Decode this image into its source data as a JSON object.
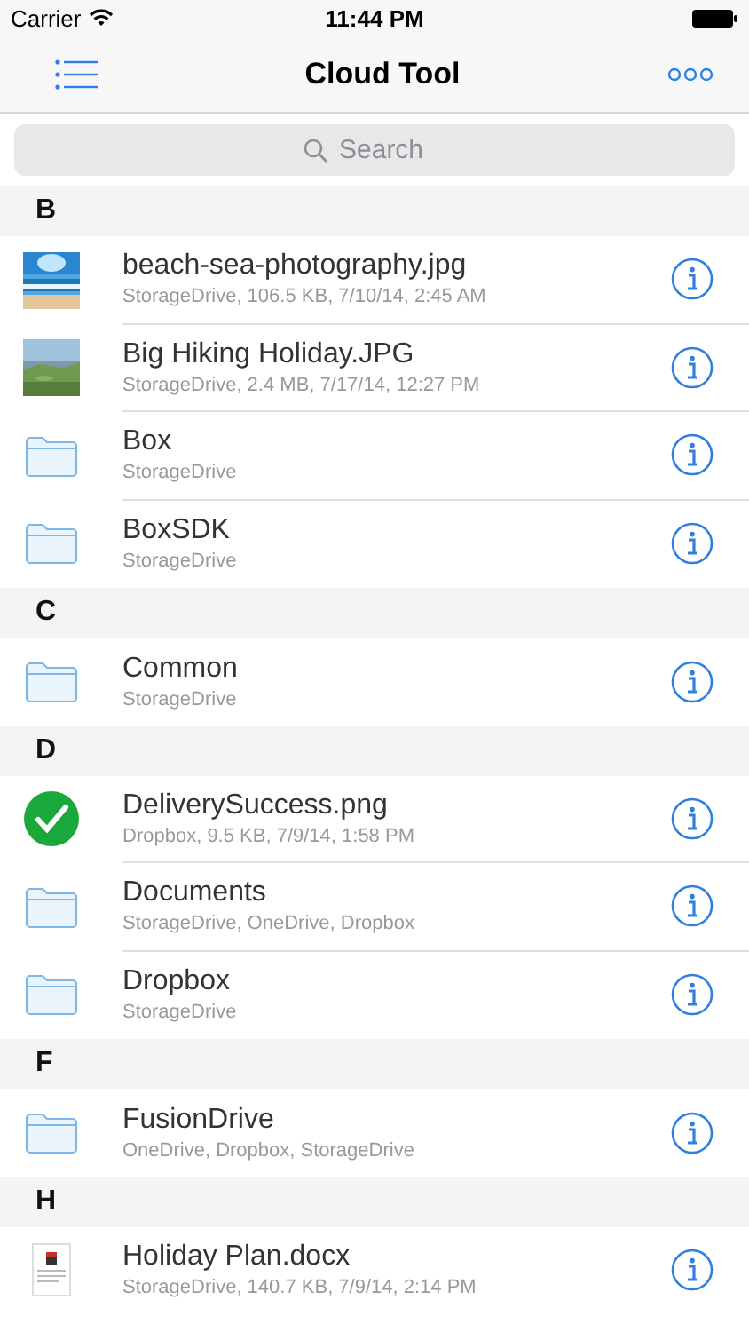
{
  "status_bar": {
    "carrier": "Carrier",
    "time": "11:44 PM"
  },
  "nav": {
    "title": "Cloud Tool"
  },
  "search": {
    "placeholder": "Search"
  },
  "sections": [
    {
      "letter": "B",
      "items": [
        {
          "kind": "picture",
          "name": "beach-sea-photography.jpg",
          "detail": "StorageDrive, 106.5 KB, 7/10/14, 2:45 AM"
        },
        {
          "kind": "picture",
          "name": "Big Hiking Holiday.JPG",
          "detail": "StorageDrive, 2.4 MB, 7/17/14, 12:27 PM"
        },
        {
          "kind": "folder",
          "name": "Box",
          "detail": "StorageDrive"
        },
        {
          "kind": "folder",
          "name": "BoxSDK",
          "detail": "StorageDrive"
        }
      ]
    },
    {
      "letter": "C",
      "items": [
        {
          "kind": "folder",
          "name": "Common",
          "detail": "StorageDrive"
        }
      ]
    },
    {
      "letter": "D",
      "items": [
        {
          "kind": "check",
          "name": "DeliverySuccess.png",
          "detail": "Dropbox, 9.5 KB, 7/9/14, 1:58 PM"
        },
        {
          "kind": "folder",
          "name": "Documents",
          "detail": "StorageDrive, OneDrive, Dropbox"
        },
        {
          "kind": "folder",
          "name": "Dropbox",
          "detail": "StorageDrive"
        }
      ]
    },
    {
      "letter": "F",
      "items": [
        {
          "kind": "folder",
          "name": "FusionDrive",
          "detail": "OneDrive, Dropbox, StorageDrive"
        }
      ]
    },
    {
      "letter": "H",
      "items": [
        {
          "kind": "document",
          "name": "Holiday Plan.docx",
          "detail": "StorageDrive, 140.7 KB, 7/9/14, 2:14 PM"
        }
      ]
    }
  ]
}
